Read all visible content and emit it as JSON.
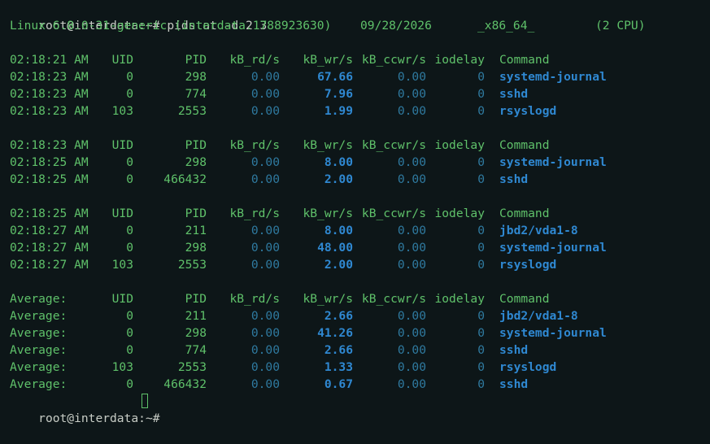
{
  "terminal": {
    "prompt": "root@interdata:~# ",
    "command": "pidstat -d 2 3",
    "sysinfo": {
      "kernel": "Linux 6.8.0-31-generic (interdata.1788923630)",
      "date": "09/28/2026",
      "arch": "_x86_64_",
      "cpus": "(2 CPU)"
    },
    "columns": [
      "UID",
      "PID",
      "kB_rd/s",
      "kB_wr/s",
      "kB_ccwr/s",
      "iodelay",
      "Command"
    ],
    "blocks": [
      {
        "header_time": "02:18:21 AM",
        "rows": [
          {
            "time": "02:18:23 AM",
            "uid": "0",
            "pid": "298",
            "rd": "0.00",
            "wr": "67.66",
            "ccwr": "0.00",
            "iodelay": "0",
            "cmd": "systemd-journal"
          },
          {
            "time": "02:18:23 AM",
            "uid": "0",
            "pid": "774",
            "rd": "0.00",
            "wr": "7.96",
            "ccwr": "0.00",
            "iodelay": "0",
            "cmd": "sshd"
          },
          {
            "time": "02:18:23 AM",
            "uid": "103",
            "pid": "2553",
            "rd": "0.00",
            "wr": "1.99",
            "ccwr": "0.00",
            "iodelay": "0",
            "cmd": "rsyslogd"
          }
        ]
      },
      {
        "header_time": "02:18:23 AM",
        "rows": [
          {
            "time": "02:18:25 AM",
            "uid": "0",
            "pid": "298",
            "rd": "0.00",
            "wr": "8.00",
            "ccwr": "0.00",
            "iodelay": "0",
            "cmd": "systemd-journal"
          },
          {
            "time": "02:18:25 AM",
            "uid": "0",
            "pid": "466432",
            "rd": "0.00",
            "wr": "2.00",
            "ccwr": "0.00",
            "iodelay": "0",
            "cmd": "sshd"
          }
        ]
      },
      {
        "header_time": "02:18:25 AM",
        "rows": [
          {
            "time": "02:18:27 AM",
            "uid": "0",
            "pid": "211",
            "rd": "0.00",
            "wr": "8.00",
            "ccwr": "0.00",
            "iodelay": "0",
            "cmd": "jbd2/vda1-8"
          },
          {
            "time": "02:18:27 AM",
            "uid": "0",
            "pid": "298",
            "rd": "0.00",
            "wr": "48.00",
            "ccwr": "0.00",
            "iodelay": "0",
            "cmd": "systemd-journal"
          },
          {
            "time": "02:18:27 AM",
            "uid": "103",
            "pid": "2553",
            "rd": "0.00",
            "wr": "2.00",
            "ccwr": "0.00",
            "iodelay": "0",
            "cmd": "rsyslogd"
          }
        ]
      },
      {
        "header_time": "Average:",
        "rows": [
          {
            "time": "Average:",
            "uid": "0",
            "pid": "211",
            "rd": "0.00",
            "wr": "2.66",
            "ccwr": "0.00",
            "iodelay": "0",
            "cmd": "jbd2/vda1-8"
          },
          {
            "time": "Average:",
            "uid": "0",
            "pid": "298",
            "rd": "0.00",
            "wr": "41.26",
            "ccwr": "0.00",
            "iodelay": "0",
            "cmd": "systemd-journal"
          },
          {
            "time": "Average:",
            "uid": "0",
            "pid": "774",
            "rd": "0.00",
            "wr": "2.66",
            "ccwr": "0.00",
            "iodelay": "0",
            "cmd": "sshd"
          },
          {
            "time": "Average:",
            "uid": "103",
            "pid": "2553",
            "rd": "0.00",
            "wr": "1.33",
            "ccwr": "0.00",
            "iodelay": "0",
            "cmd": "rsyslogd"
          },
          {
            "time": "Average:",
            "uid": "0",
            "pid": "466432",
            "rd": "0.00",
            "wr": "0.67",
            "ccwr": "0.00",
            "iodelay": "0",
            "cmd": "sshd"
          }
        ]
      }
    ],
    "final_prompt": "root@interdata:~# "
  },
  "colors": {
    "background": "#0d1618",
    "text": "#c7ccc5",
    "green": "#5fc16a",
    "command": "#2f88d1",
    "dim_value": "#2f7aa0"
  }
}
